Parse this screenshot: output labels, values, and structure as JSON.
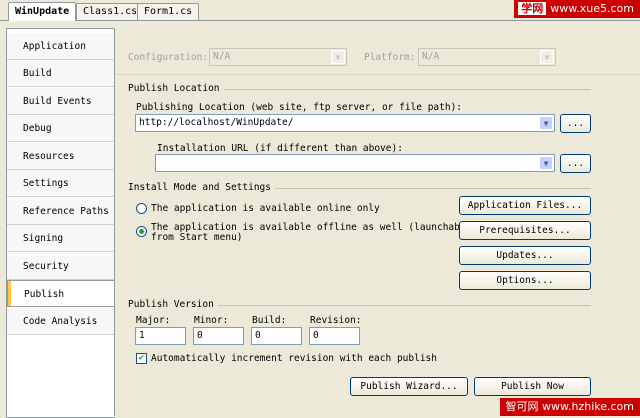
{
  "tabs": [
    "WinUpdate",
    "Class1.cs",
    "Form1.cs"
  ],
  "watermark_top": {
    "brand": "学网",
    "url": "www.xue5.com"
  },
  "watermark_bottom": "智可网 www.hzhike.com",
  "nav": [
    "Application",
    "Build",
    "Build Events",
    "Debug",
    "Resources",
    "Settings",
    "Reference Paths",
    "Signing",
    "Security",
    "Publish",
    "Code Analysis"
  ],
  "selected_nav": "Publish",
  "config": {
    "configuration_label": "Configuration:",
    "configuration_value": "N/A",
    "platform_label": "Platform:",
    "platform_value": "N/A"
  },
  "publish_location": {
    "group": "Publish Location",
    "location_label": "Publishing Location (web site, ftp server, or file path):",
    "location_value": "http://localhost/WinUpdate/",
    "install_url_label": "Installation URL (if different than above):",
    "install_url_value": "",
    "browse": "..."
  },
  "install_mode": {
    "group": "Install Mode and Settings",
    "online_only": "The application is available online only",
    "offline_line1": "The application is available offline as well (launchable",
    "offline_line2": "from Start menu)",
    "selected": "offline",
    "buttons": {
      "files": "Application Files...",
      "prereq": "Prerequisites...",
      "updates": "Updates...",
      "options": "Options..."
    }
  },
  "publish_version": {
    "group": "Publish Version",
    "major_label": "Major:",
    "minor_label": "Minor:",
    "build_label": "Build:",
    "revision_label": "Revision:",
    "major": "1",
    "minor": "0",
    "build": "0",
    "revision": "0",
    "auto_increment_label": "Automatically increment revision with each publish",
    "auto_increment": true
  },
  "actions": {
    "wizard": "Publish Wizard...",
    "publish_now": "Publish Now"
  }
}
